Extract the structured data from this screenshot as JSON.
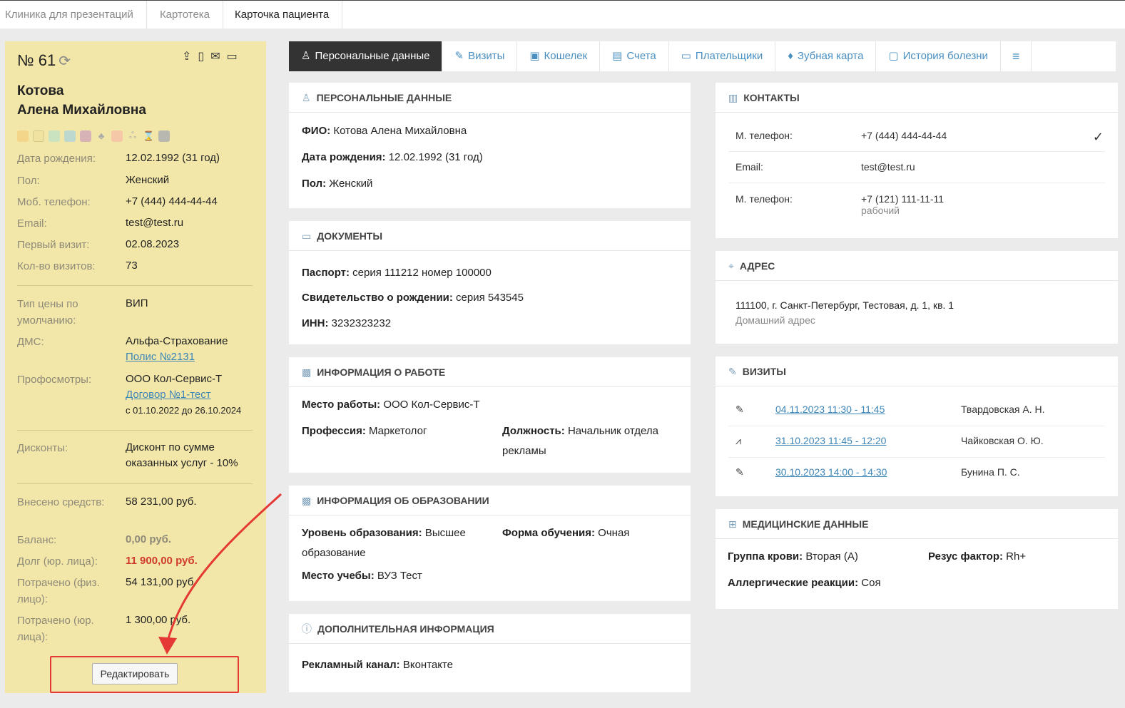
{
  "topbar": {
    "tabs": [
      "Клиника для презентаций",
      "Картотека",
      "Карточка пациента"
    ]
  },
  "card": {
    "number": "№ 61",
    "last_name": "Котова",
    "first_names": "Алена Михайловна",
    "swatch_colors": [
      "#f4d58a",
      "#f0e2a0",
      "#c9e3c1",
      "#bcd8cf",
      "#d7b3b8",
      "#f5c9a8",
      "#b8b8b0"
    ],
    "fields": {
      "dob_label": "Дата рождения:",
      "dob": "12.02.1992 (31 год)",
      "sex_label": "Пол:",
      "sex": "Женский",
      "phone_label": "Моб. телефон:",
      "phone": "+7 (444) 444-44-44",
      "email_label": "Email:",
      "email": "test@test.ru",
      "first_visit_label": "Первый визит:",
      "first_visit": "02.08.2023",
      "visits_label": "Кол-во визитов:",
      "visits": "73",
      "price_label": "Тип цены по умолчанию:",
      "price": "ВИП",
      "dms_label": "ДМС:",
      "dms": "Альфа-Страхование",
      "dms_link": "Полис №2131",
      "prof_label": "Профосмотры:",
      "prof": "ООО Кол-Сервис-Т",
      "prof_link": "Договор №1-тест",
      "prof_period": "с 01.10.2022 до 26.10.2024",
      "discount_label": "Дисконты:",
      "discount": "Дисконт по сумме оказанных услуг - 10%",
      "paid_label": "Внесено средств:",
      "paid": "58 231,00 руб.",
      "balance_label": "Баланс:",
      "balance": "0,00 руб.",
      "debt_label": "Долг (юр. лица):",
      "debt": "11 900,00 руб.",
      "spent_ind_label": "Потрачено (физ. лицо):",
      "spent_ind": "54 131,00 руб.",
      "spent_jur_label": "Потрачено (юр. лица):",
      "spent_jur": "1 300,00 руб."
    },
    "edit_button": "Редактировать"
  },
  "tabs": [
    {
      "label": "Персональные данные",
      "icon": "user-icon"
    },
    {
      "label": "Визиты",
      "icon": "edit-icon"
    },
    {
      "label": "Кошелек",
      "icon": "wallet-icon"
    },
    {
      "label": "Счета",
      "icon": "receipt-icon"
    },
    {
      "label": "Плательщики",
      "icon": "card-icon"
    },
    {
      "label": "Зубная карта",
      "icon": "tooth-icon"
    },
    {
      "label": "История болезни",
      "icon": "clipboard-icon"
    }
  ],
  "personal": {
    "title": "ПЕРСОНАЛЬНЫЕ ДАННЫЕ",
    "fio_label": "ФИО:",
    "fio": "Котова Алена Михайловна",
    "dob_label": "Дата рождения:",
    "dob": "12.02.1992 (31 год)",
    "sex_label": "Пол:",
    "sex": "Женский"
  },
  "documents": {
    "title": "ДОКУМЕНТЫ",
    "passport_label": "Паспорт:",
    "passport": "серия 111212 номер 100000",
    "birth_label": "Свидетельство о рождении:",
    "birth": "серия 543545",
    "inn_label": "ИНН:",
    "inn": "3232323232"
  },
  "work": {
    "title": "ИНФОРМАЦИЯ О РАБОТЕ",
    "place_label": "Место работы:",
    "place": "ООО Кол-Сервис-Т",
    "profession_label": "Профессия:",
    "profession": "Маркетолог",
    "position_label": "Должность:",
    "position": "Начальник отдела рекламы"
  },
  "education": {
    "title": "ИНФОРМАЦИЯ ОБ ОБРАЗОВАНИИ",
    "level_label": "Уровень образования:",
    "level": "Высшее образование",
    "form_label": "Форма обучения:",
    "form": "Очная",
    "place_label": "Место учебы:",
    "place": "ВУЗ Тест"
  },
  "additional": {
    "title": "ДОПОЛНИТЕЛЬНАЯ ИНФОРМАЦИЯ",
    "channel_label": "Рекламный канал:",
    "channel": "Вконтакте"
  },
  "contacts": {
    "title": "КОНТАКТЫ",
    "rows": [
      {
        "label": "М. телефон:",
        "value": "+7 (444) 444-44-44",
        "note": ""
      },
      {
        "label": "Email:",
        "value": "test@test.ru",
        "note": ""
      },
      {
        "label": "М. телефон:",
        "value": "+7 (121) 111-11-11",
        "note": "рабочий"
      }
    ]
  },
  "address": {
    "title": "АДРЕС",
    "value": "111100, г. Санкт-Петербург, Тестовая, д. 1, кв. 1",
    "note": "Домашний адрес"
  },
  "visits": {
    "title": "ВИЗИТЫ",
    "rows": [
      {
        "icon": "pencil-icon",
        "date": "04.11.2023 11:30 - 11:45",
        "doctor": "Твардовская А. Н."
      },
      {
        "icon": "pulse-icon",
        "date": "31.10.2023 11:45 - 12:20",
        "doctor": "Чайковская О. Ю."
      },
      {
        "icon": "pencil-icon",
        "date": "30.10.2023 14:00 - 14:30",
        "doctor": "Бунина П. С."
      }
    ]
  },
  "medical": {
    "title": "МЕДИЦИНСКИЕ ДАННЫЕ",
    "blood_label": "Группа крови:",
    "blood": "Вторая (A)",
    "rh_label": "Резус фактор:",
    "rh": "Rh+",
    "allergy_label": "Аллергические реакции:",
    "allergy": "Соя"
  }
}
